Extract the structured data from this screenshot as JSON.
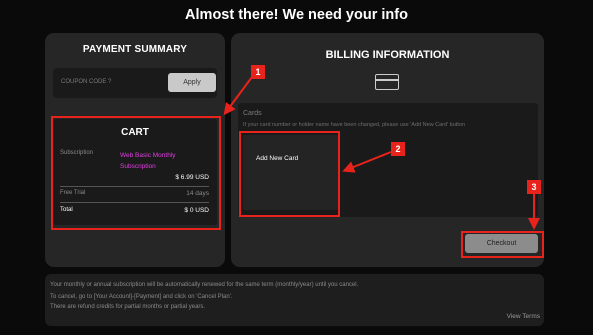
{
  "page": {
    "title": "Almost there! We need your info"
  },
  "summary": {
    "title": "PAYMENT SUMMARY",
    "coupon_label": "COUPON CODE ?",
    "apply_label": "Apply",
    "cart": {
      "title": "CART",
      "subscription_label": "Subscription",
      "subscription_value": "Web Basic Monthly Subscription",
      "price": "$ 6.99 USD",
      "trial_label": "Free Trial",
      "trial_value": "14 days",
      "total_label": "Total",
      "total_value": "$ 0 USD"
    }
  },
  "billing": {
    "title": "BILLING INFORMATION",
    "card_icon": "credit-card-icon",
    "cards_label": "Cards",
    "cards_note": "If your card number or holder name have been changed, please use 'Add New Card' button",
    "add_card_label": "Add New Card",
    "checkout_label": "Checkout"
  },
  "notice": {
    "line1": "Your monthly or annual subscription will be automatically renewed for the same term (monthly/year) until you cancel.",
    "line2": "To cancel, go to [Your Account]-[Payment] and click on 'Cancel Plan'.",
    "line3": "There are refund credits for partial months or partial years.",
    "terms_label": "View Terms"
  },
  "annotations": {
    "badge1": "1",
    "badge2": "2",
    "badge3": "3"
  },
  "colors": {
    "highlight": "#e8231c",
    "accent_magenta": "#e33ee3",
    "background": "#0a0a0a",
    "panel": "#262626"
  }
}
